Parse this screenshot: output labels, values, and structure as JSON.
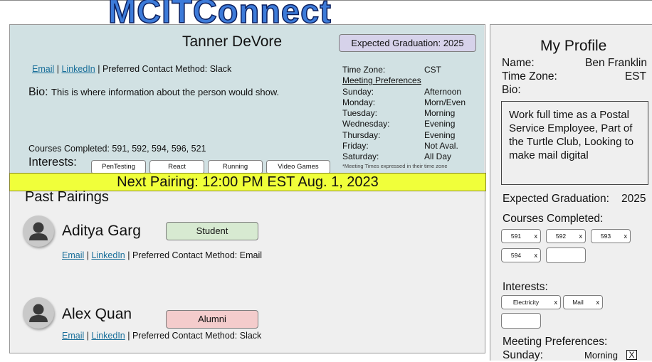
{
  "app": {
    "logo": "MCITConnect"
  },
  "match": {
    "name": "Tanner DeVore",
    "graduation": "Expected Graduation: 2025",
    "email": "Email",
    "linkedin": "LinkedIn",
    "sep": "|",
    "contact_method": "Preferred Contact Method: Slack",
    "bio_label": "Bio:",
    "bio_text": "This is where information about the person would show.",
    "courses": "Courses Completed: 591, 592, 594, 596, 521",
    "interests_label": "Interests:",
    "interests": [
      "PenTesting",
      "React",
      "Running",
      "Video Games"
    ],
    "timezone_label": "Time Zone:",
    "timezone": "CST",
    "meeting_pref_title": "Meeting Preferences",
    "schedule": [
      {
        "day": "Sunday:",
        "time": "Afternoon"
      },
      {
        "day": "Monday:",
        "time": "Morn/Even"
      },
      {
        "day": "Tuesday:",
        "time": "Morning"
      },
      {
        "day": "Wednesday:",
        "time": "Evening"
      },
      {
        "day": "Thursday:",
        "time": "Evening"
      },
      {
        "day": "Friday:",
        "time": "Not Aval."
      },
      {
        "day": "Saturday:",
        "time": "All Day"
      }
    ],
    "schedule_note": "*Meeting Times expressed in their time zone"
  },
  "next_pairing": "Next Pairing: 12:00 PM EST Aug. 1, 2023",
  "past": {
    "title": "Past Pairings",
    "items": [
      {
        "name": "Aditya Garg",
        "tag": "Student",
        "tag_color": "#d7ead1",
        "email": "Email",
        "linkedin": "LinkedIn",
        "contact": "Preferred Contact Method: Email"
      },
      {
        "name": "Alex Quan",
        "tag": "Alumni",
        "tag_color": "#f4cccc",
        "email": "Email",
        "linkedin": "LinkedIn",
        "contact": "Preferred Contact Method: Slack"
      }
    ]
  },
  "profile": {
    "title": "My Profile",
    "name_label": "Name:",
    "name": "Ben Franklin",
    "tz_label": "Time Zone:",
    "tz": "EST",
    "bio_label": "Bio:",
    "bio": "Work full time as a Postal Service Employee, Part of the Turtle Club, Looking to make mail digital",
    "grad_label": "Expected Graduation:",
    "grad": "2025",
    "courses_label": "Courses Completed:",
    "courses": [
      "591",
      "592",
      "593",
      "594"
    ],
    "interests_label": "Interests:",
    "interests": [
      "Electricity",
      "Mail"
    ],
    "chip_remove": "x",
    "meeting_label": "Meeting Preferences:",
    "sunday_label": "Sunday:",
    "sunday_value": "Morning",
    "sunday_toggle": "X"
  },
  "colors": {
    "accent_logo": "#3d7bd9",
    "card_bg": "#d1e1e3",
    "banner": "#f0ff3a",
    "grad_box": "#d6d2ea"
  }
}
